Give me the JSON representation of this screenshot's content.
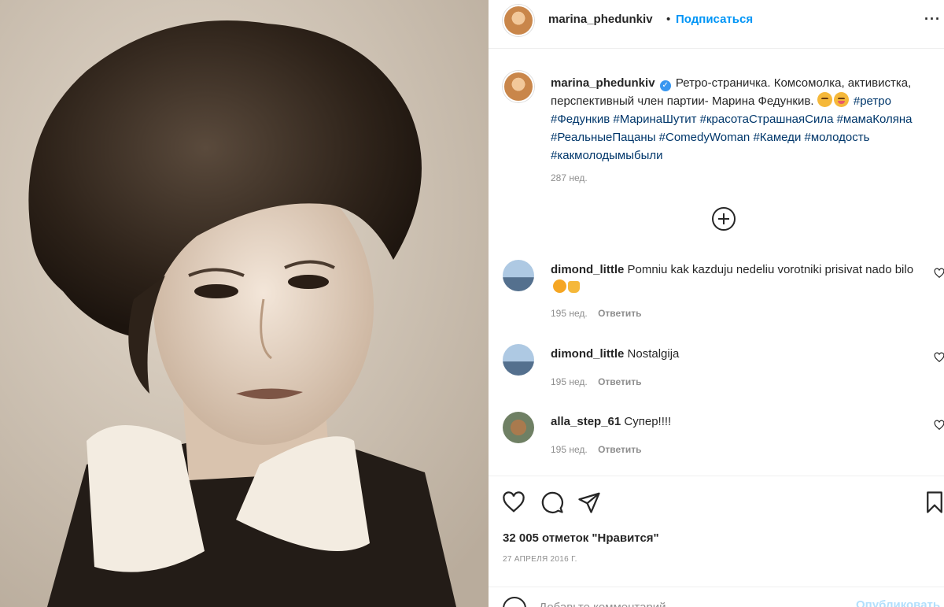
{
  "post": {
    "username": "marina_phedunkiv",
    "separator": "•",
    "follow_label": "Подписаться",
    "more_icon": "more-horizontal-icon",
    "more_label": "···"
  },
  "caption": {
    "username": "marina_phedunkiv",
    "verified_mark": "✓",
    "text": "Ретро-страничка. Комсомолка, активистка, перспективный член партии- Марина Федункив.",
    "hashtags": [
      "#ретро",
      "#Федункив",
      "#МаринаШутит",
      "#красотаСтрашнаяСила",
      "#мамаКоляна",
      "#РеальныеПацаны",
      "#ComedyWoman",
      "#Камеди",
      "#молодость",
      "#какмолодымыбыли"
    ],
    "time": "287 нед."
  },
  "comments": [
    {
      "username": "dimond_little",
      "text": "Pomniu kak kazduju nedeliu vorotniki prisivat nado bilo",
      "time": "195 нед.",
      "reply_label": "Ответить"
    },
    {
      "username": "dimond_little",
      "text": "Nostalgija",
      "time": "195 нед.",
      "reply_label": "Ответить"
    },
    {
      "username": "alla_step_61",
      "text": "Супер!!!!",
      "time": "195 нед.",
      "reply_label": "Ответить"
    }
  ],
  "actions": {
    "likes_label": "32 005 отметок \"Нравится\"",
    "date": "27 апреля 2016 г.",
    "icons": [
      "heart-icon",
      "comment-icon",
      "share-icon",
      "bookmark-icon"
    ]
  },
  "add_comment": {
    "placeholder": "Добавьте комментарий...",
    "publish_label": "Опубликовать"
  },
  "colors": {
    "accent": "#0095f6",
    "hashtag": "#00376b",
    "muted": "#8e8e8e",
    "text": "#262626"
  }
}
